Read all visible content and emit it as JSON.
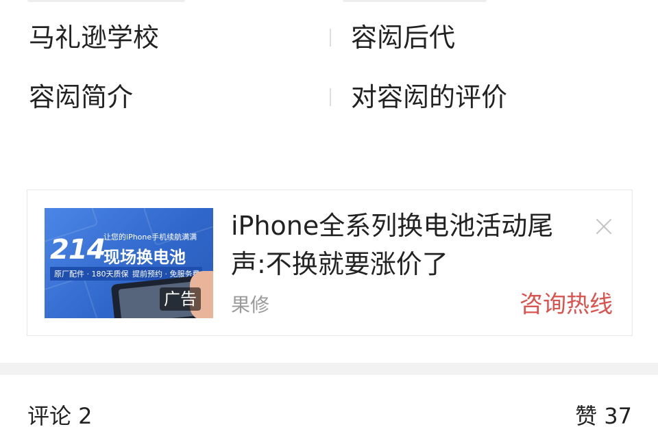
{
  "related": {
    "items": [
      {
        "label": "马礼逊学校"
      },
      {
        "label": "容闳后代"
      },
      {
        "label": "容闳简介"
      },
      {
        "label": "对容闳的评价"
      }
    ]
  },
  "ad": {
    "image": {
      "number": "214",
      "tagline": "让您的iPhone手机续航满满",
      "headline": "现场换电池",
      "bar_left": "原厂配件 · 180天质保",
      "bar_right": "提前预约 · 免服务费",
      "badge": "广告"
    },
    "title": "iPhone全系列换电池活动尾声:不换就要涨价了",
    "source": "果修",
    "cta": "咨询热线",
    "close_icon": "close-icon"
  },
  "comments": {
    "label": "评论 2"
  },
  "likes": {
    "label": "赞 37"
  },
  "colors": {
    "cta": "#d9534f",
    "ad_bg": "#3a73d8",
    "gap": "#f2f2f2"
  }
}
